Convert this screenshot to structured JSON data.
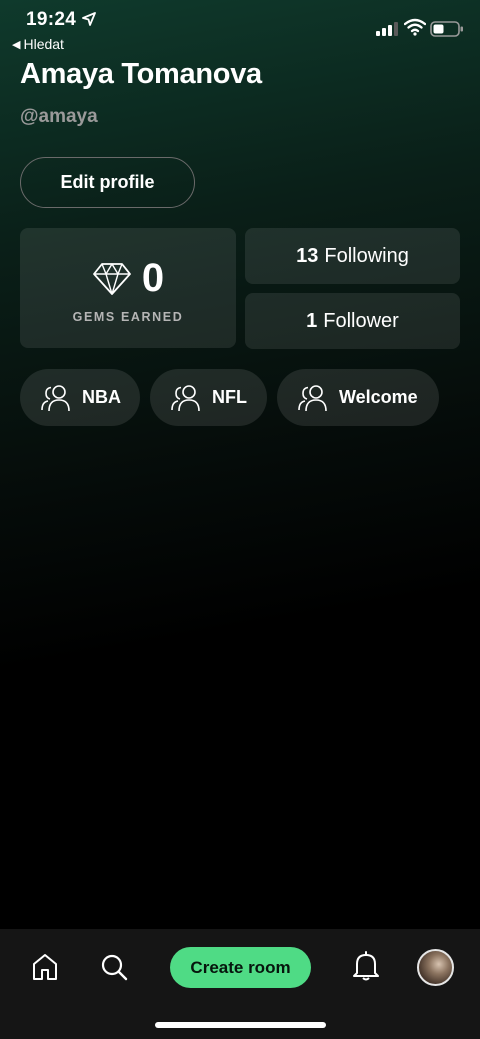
{
  "status_bar": {
    "time": "19:24",
    "back_label": "Hledat"
  },
  "profile": {
    "name": "Amaya Tomanova",
    "handle": "@amaya",
    "edit_label": "Edit profile"
  },
  "stats": {
    "gems_value": "0",
    "gems_label": "GEMS EARNED",
    "following_count": "13",
    "following_label": "Following",
    "follower_count": "1",
    "follower_label": "Follower"
  },
  "rooms": [
    {
      "label": "NBA"
    },
    {
      "label": "NFL"
    },
    {
      "label": "Welcome"
    }
  ],
  "bottom_nav": {
    "create_label": "Create room",
    "accent_color": "#4fdb85"
  },
  "icons": [
    "location-arrow-icon",
    "signal-icon",
    "wifi-icon",
    "battery-icon",
    "diamond-icon",
    "people-icon",
    "home-icon",
    "search-icon",
    "bell-icon"
  ]
}
